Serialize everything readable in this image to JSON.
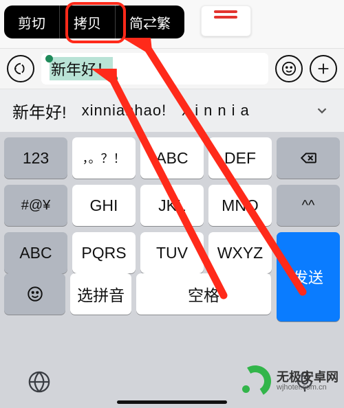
{
  "context_menu": {
    "cut": "剪切",
    "copy": "拷贝",
    "convert": "简⇄繁"
  },
  "input": {
    "text": "新年好！"
  },
  "candidates": {
    "a": "新年好!",
    "b": "xinnianhao!",
    "c": "xinnia",
    "expand_icon": "chevron-down"
  },
  "keys": {
    "r1": {
      "k1": "123",
      "k2": "，。？！",
      "k3": "ABC",
      "k4": "DEF",
      "k5_icon": "backspace"
    },
    "r2": {
      "k1": "#@¥",
      "k2": "GHI",
      "k3": "JKL",
      "k4": "MNO",
      "k5": "^^"
    },
    "r3": {
      "k1": "ABC",
      "k2": "PQRS",
      "k3": "TUV",
      "k4": "WXYZ",
      "k5_line1": "",
      "k5_line2": "发送"
    },
    "r4": {
      "k1_icon": "emoji",
      "k2": "选拼音",
      "k3": "空格"
    }
  },
  "bottom": {
    "globe_icon": "globe",
    "mic_icon": "microphone"
  },
  "watermark": {
    "zh": "无极安卓网",
    "en": "wjhotel.com.cn"
  },
  "colors": {
    "annotation": "#ff2a1a",
    "send_key": "#0a7cff",
    "brand": "#32b54a",
    "selection": "#b9e3d6"
  }
}
